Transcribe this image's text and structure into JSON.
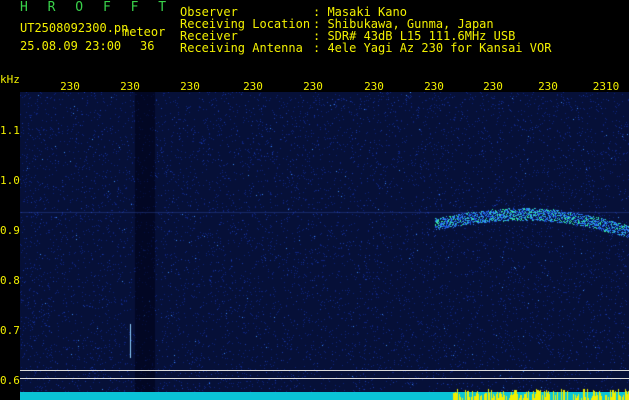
{
  "header": {
    "title": "H R O F F T",
    "filename": "UT2508092300.pn",
    "meteor_label": "meteor",
    "timestamp": "25.08.09 23:00",
    "meteor_count": "36",
    "fields": [
      {
        "label": "Observer",
        "value": ": Masaki Kano"
      },
      {
        "label": "Receiving Location",
        "value": ": Shibukawa, Gunma, Japan"
      },
      {
        "label": "Receiver",
        "value": ": SDR# 43dB L15 111.6MHz USB"
      },
      {
        "label": "Receiving Antenna",
        "value": ": 4ele Yagi Az 230 for Kansai VOR"
      }
    ]
  },
  "axes": {
    "y_unit": "kHz",
    "y_ticks": [
      "1.1",
      "1.0",
      "0.9",
      "0.8",
      "0.7",
      "0.6"
    ],
    "x_ticks": [
      "230",
      "230",
      "230",
      "230",
      "230",
      "230",
      "230",
      "230",
      "230",
      "2310"
    ]
  },
  "colors": {
    "background": "#000000",
    "noise": "#07123d",
    "axis_text": "#f2f000",
    "title": "#39d24a",
    "baseline": "#0ac3d6"
  }
}
